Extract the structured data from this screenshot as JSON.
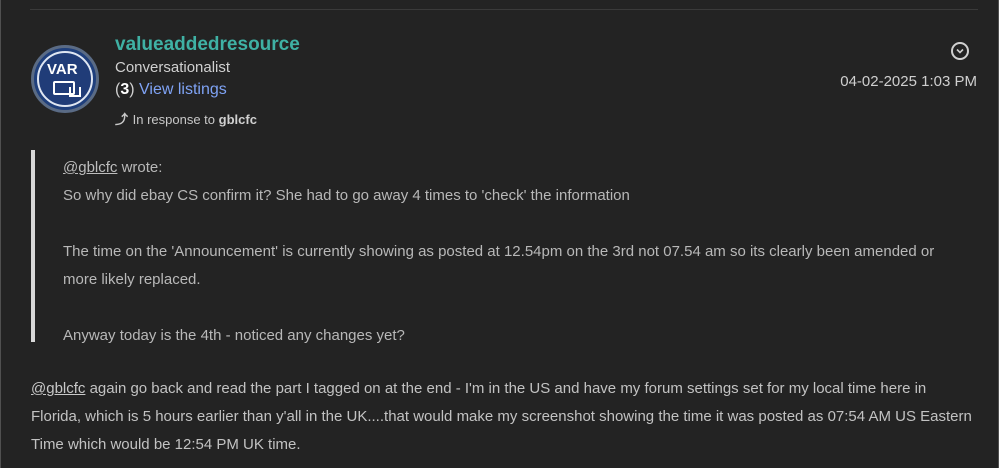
{
  "post": {
    "author": {
      "avatar_text": "VAR",
      "username": "valueaddedresource",
      "rank": "Conversationalist",
      "feedback_open": "(",
      "feedback_count": "3",
      "feedback_close": ")",
      "view_listings": "View listings"
    },
    "in_response_to_label": "In response to",
    "in_response_to_user": "gblcfc",
    "options_icon": "chevron-down-circle-icon",
    "timestamp": "04-02-2025 1:03 PM",
    "quote": {
      "mention": "@gblcfc",
      "wrote": " wrote:",
      "lines": [
        "So why did ebay CS confirm it?  She had to go away 4 times to 'check' the information",
        "The time on the 'Announcement' is currently showing as posted at 12.54pm on the 3rd not 07.54 am so its clearly been amended or more likely replaced.",
        "Anyway today is the 4th - noticed any changes yet?"
      ]
    },
    "reply": {
      "mention": "@gblcfc",
      "text": "  again go back and read the part I tagged on at the end - I'm in the US and have my forum settings set for my local time here in Florida, which is 5 hours earlier than y'all in the UK....that would make my screenshot showing the time it was posted as 07:54 AM US Eastern Time which would be 12:54 PM UK time."
    }
  },
  "colors": {
    "background": "#232323",
    "username": "#3fb1a4",
    "link": "#7fa3f5",
    "quote_bar": "#d8d8d8"
  }
}
